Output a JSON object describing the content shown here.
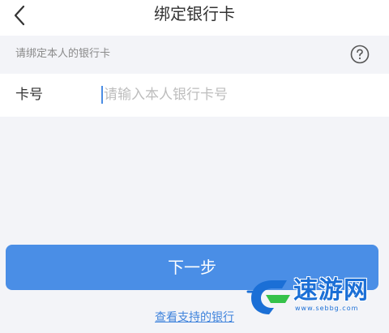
{
  "header": {
    "back_icon": "chevron-left-icon",
    "title": "绑定银行卡"
  },
  "hint": {
    "text": "请绑定本人的银行卡",
    "help_icon": "question-circle-icon"
  },
  "card_field": {
    "label": "卡号",
    "value": "",
    "placeholder": "请输入本人银行卡号"
  },
  "actions": {
    "next_label": "下一步",
    "supported_banks_link": "查看支持的银行"
  },
  "watermark": {
    "text": "速游网",
    "url": "www.sebbg.com"
  },
  "colors": {
    "primary": "#4a8ee6",
    "link": "#3f83dc",
    "background": "#f3f4f8",
    "watermark": "#1b6fd6"
  }
}
